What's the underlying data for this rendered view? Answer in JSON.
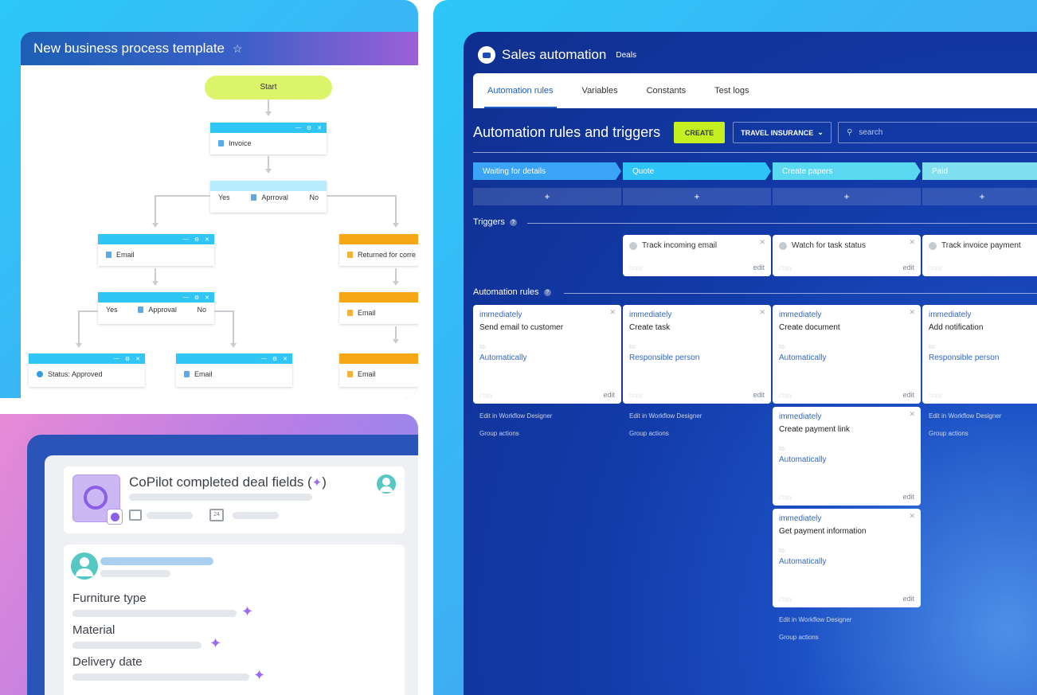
{
  "bp": {
    "title": "New business process template",
    "start": "Start",
    "invoice": "Invoice",
    "yes": "Yes",
    "no": "No",
    "approval1": "Aprroval",
    "approval2": "Approval",
    "email": "Email",
    "returned": "Returned for corre",
    "status": "Status: Approved"
  },
  "copilot": {
    "title": "CoPilot completed deal fields (",
    "title_end": ")",
    "calendar_day": "24",
    "fields": [
      "Furniture type",
      "Material",
      "Delivery date"
    ]
  },
  "sa": {
    "title": "Sales automation",
    "subtitle": "Deals",
    "tabs": [
      "Automation rules",
      "Variables",
      "Constants",
      "Test logs"
    ],
    "heading": "Automation rules and triggers",
    "create": "CREATE",
    "pipeline": "TRAVEL INSURANCE",
    "search_placeholder": "search",
    "stages": [
      "Waiting for details",
      "Quote",
      "Create papers",
      "Paid"
    ],
    "stage_colors": [
      "#3aa4f6",
      "#2ec4f8",
      "#5ad8f2",
      "#7fdff0"
    ],
    "triggers_label": "Triggers",
    "rules_label": "Automation rules",
    "triggers": [
      "Track incoming email",
      "Watch for task status",
      "Track invoice payment"
    ],
    "copy": "copy",
    "edit": "edit",
    "to": "to:",
    "rules": [
      {
        "when": "immediately",
        "name": "Send email to customer",
        "who": "Automatically"
      },
      {
        "when": "immediately",
        "name": "Create task",
        "who": "Responsible person"
      },
      {
        "when": "immediately",
        "name": "Create document",
        "who": "Automatically"
      },
      {
        "when": "immediately",
        "name": "Add notification",
        "who": "Responsible person"
      },
      {
        "when": "immediately",
        "name": "Create payment link",
        "who": "Automatically"
      },
      {
        "when": "immediately",
        "name": "Get payment information",
        "who": "Automatically"
      }
    ],
    "edit_designer": "Edit in Workflow Designer",
    "group_actions": "Group actions"
  }
}
